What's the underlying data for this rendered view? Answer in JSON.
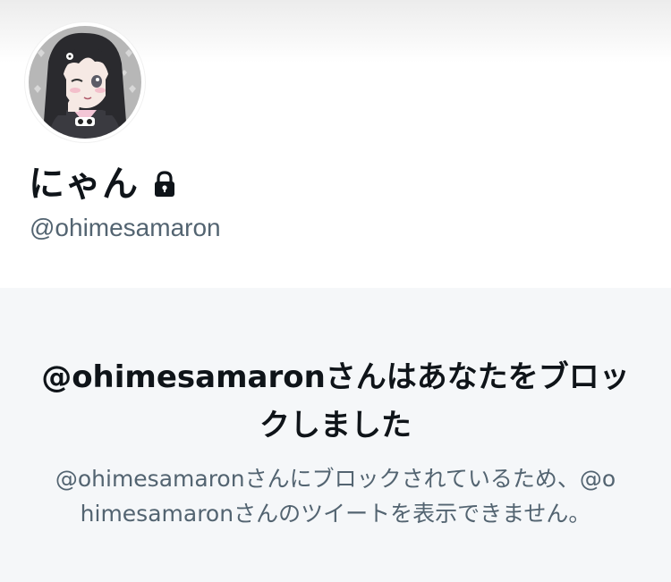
{
  "profile": {
    "display_name": "にゃん",
    "handle": "@ohimesamaron",
    "avatar_icon": "avatar-anime-girl",
    "lock_icon": "lock-icon"
  },
  "blocked_notice": {
    "title": "@ohimesamaronさんはあなたをブロックしました",
    "description": "@ohimesamaronさんにブロックされているため、@ohimesamaronさんのツイートを表示できません。"
  },
  "colors": {
    "text_primary": "#0f1419",
    "text_secondary": "#536471",
    "panel_background": "#f5f7f9"
  }
}
